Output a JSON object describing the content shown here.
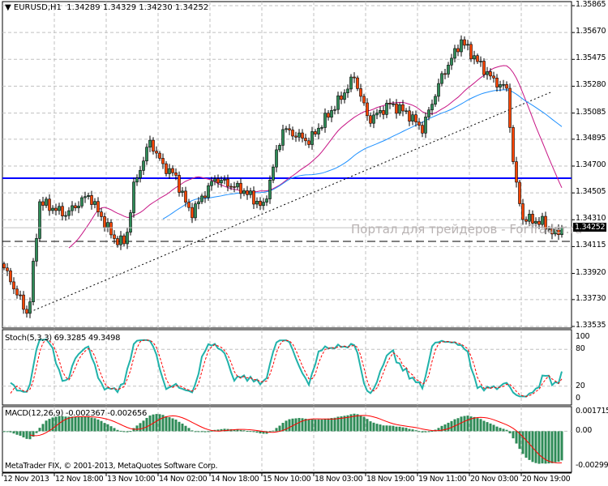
{
  "header": {
    "symbol": "EURUSD,H1",
    "open": "1.34289",
    "high": "1.34329",
    "low": "1.34230",
    "close": "1.34252"
  },
  "watermark": "Портал для трейдеров - ForTrader.ru",
  "copyright": "MetaTrader FIX, © 2001-2013, MetaQuotes Software Corp.",
  "colors": {
    "bull": "#2e8b57",
    "bear": "#ff4500",
    "ma_fast": "#c71585",
    "ma_slow": "#1e90ff",
    "level": "#0000ff",
    "stoch_main": "#20b2aa",
    "stoch_signal": "#ff0000",
    "macd_hist": "#2e8b57",
    "macd_signal": "#ff0000"
  },
  "chart_data": [
    {
      "type": "candlestick",
      "title": "EURUSD,H1",
      "price_ticks": [
        "1.35865",
        "1.35670",
        "1.35475",
        "1.35280",
        "1.35085",
        "1.34895",
        "1.34700",
        "1.34505",
        "1.34310",
        "1.34115",
        "1.33920",
        "1.33730",
        "1.33535"
      ],
      "ylim": [
        1.33535,
        1.35865
      ],
      "current_price": "1.34252",
      "approx_close_keyframes": [
        [
          0,
          1.3396
        ],
        [
          7.5,
          1.3361
        ],
        [
          11,
          1.3444
        ],
        [
          19,
          1.3435
        ],
        [
          26,
          1.3449
        ],
        [
          34,
          1.3417
        ],
        [
          37.5,
          1.3414
        ],
        [
          40,
          1.3455
        ],
        [
          45,
          1.3488
        ],
        [
          49,
          1.347
        ],
        [
          52.5,
          1.3464
        ],
        [
          57.5,
          1.3435
        ],
        [
          65,
          1.3461
        ],
        [
          74,
          1.3452
        ],
        [
          80,
          1.344
        ],
        [
          84,
          1.3479
        ],
        [
          86,
          1.3497
        ],
        [
          94,
          1.3488
        ],
        [
          104,
          1.352
        ],
        [
          108,
          1.3535
        ],
        [
          112.5,
          1.3503
        ],
        [
          119,
          1.3515
        ],
        [
          124,
          1.3509
        ],
        [
          129,
          1.3497
        ],
        [
          135,
          1.3535
        ],
        [
          141,
          1.3561
        ],
        [
          146,
          1.3546
        ],
        [
          151,
          1.3532
        ],
        [
          155,
          1.3526
        ],
        [
          157.5,
          1.3461
        ],
        [
          160,
          1.3432
        ],
        [
          166,
          1.3429
        ],
        [
          170,
          1.342
        ],
        [
          172,
          1.34252
        ]
      ],
      "horizontal_levels": [
        1.34612,
        1.34153
      ],
      "trendline": [
        [
          8,
          1.3364
        ],
        [
          169,
          1.3524
        ]
      ],
      "time_labels": [
        "12 Nov 2013",
        "12 Nov 18:00",
        "13 Nov 10:00",
        "14 Nov 02:00",
        "14 Nov 18:00",
        "15 Nov 10:00",
        "18 Nov 03:00",
        "18 Nov 19:00",
        "19 Nov 11:00",
        "20 Nov 03:00",
        "20 Nov 19:00"
      ]
    },
    {
      "type": "line",
      "title": "Stoch(5,3,3) 69.3285 49.3498",
      "ticks": [
        "100",
        "80",
        "20",
        "0"
      ],
      "ylim": [
        0,
        100
      ]
    },
    {
      "type": "bar",
      "title": "MACD(12,26,9) -0.002367 -0.002656",
      "ticks": [
        "0.001715",
        "0.00",
        "-0.002994"
      ],
      "ylim": [
        -0.002994,
        0.001715
      ]
    }
  ]
}
